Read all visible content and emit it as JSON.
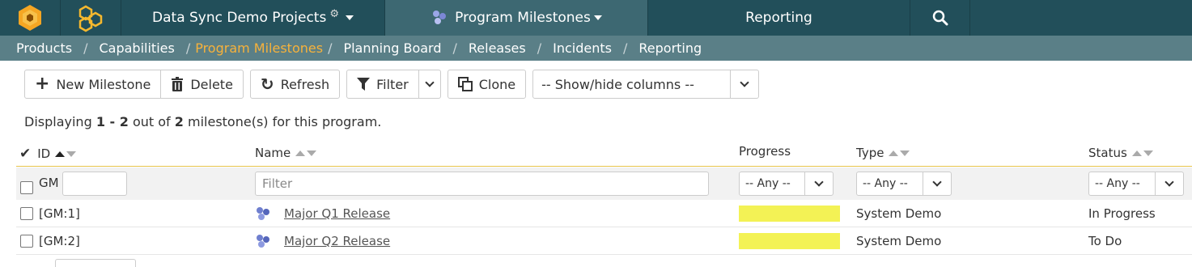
{
  "nav": {
    "project": "Data Sync Demo Projects",
    "milestones": "Program Milestones",
    "reporting": "Reporting",
    "brand_color": "#224f5a",
    "active_color": "#3d6872"
  },
  "subnav": {
    "items": [
      "Products",
      "Capabilities",
      "Program Milestones",
      "Planning Board",
      "Releases",
      "Incidents",
      "Reporting"
    ],
    "separator": "/",
    "active_color": "#f7b23b"
  },
  "toolbar": {
    "new_label": "New Milestone",
    "delete_label": "Delete",
    "refresh_label": "Refresh",
    "filter_label": "Filter",
    "clone_label": "Clone",
    "columns_label": "-- Show/hide columns --"
  },
  "summary": {
    "prefix": "Displaying",
    "range": "1 - 2",
    "mid": "out of",
    "total": "2",
    "suffix": "milestone(s) for this program."
  },
  "table": {
    "headers": {
      "id": "ID",
      "name": "Name",
      "progress": "Progress",
      "type": "Type",
      "status": "Status"
    },
    "filter": {
      "id_prefix": "GM",
      "name_placeholder": "Filter",
      "any": "-- Any --"
    },
    "rows": [
      {
        "id": "[GM:1]",
        "name": "Major Q1 Release",
        "progress": 1.0,
        "type": "System Demo",
        "status": "In Progress"
      },
      {
        "id": "[GM:2]",
        "name": "Major Q2 Release",
        "progress": 1.0,
        "type": "System Demo",
        "status": "To Do"
      }
    ],
    "progress_color": "#f3f255"
  }
}
